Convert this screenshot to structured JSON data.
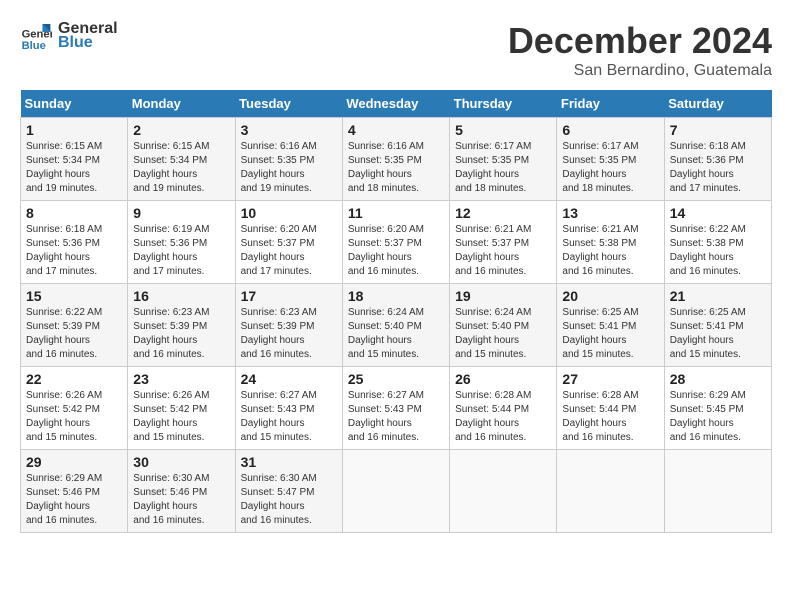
{
  "logo": {
    "line1": "General",
    "line2": "Blue"
  },
  "title": "December 2024",
  "location": "San Bernardino, Guatemala",
  "days_of_week": [
    "Sunday",
    "Monday",
    "Tuesday",
    "Wednesday",
    "Thursday",
    "Friday",
    "Saturday"
  ],
  "weeks": [
    [
      {
        "num": "1",
        "sunrise": "6:15 AM",
        "sunset": "5:34 PM",
        "daylight": "11 hours and 19 minutes."
      },
      {
        "num": "2",
        "sunrise": "6:15 AM",
        "sunset": "5:34 PM",
        "daylight": "11 hours and 19 minutes."
      },
      {
        "num": "3",
        "sunrise": "6:16 AM",
        "sunset": "5:35 PM",
        "daylight": "11 hours and 19 minutes."
      },
      {
        "num": "4",
        "sunrise": "6:16 AM",
        "sunset": "5:35 PM",
        "daylight": "11 hours and 18 minutes."
      },
      {
        "num": "5",
        "sunrise": "6:17 AM",
        "sunset": "5:35 PM",
        "daylight": "11 hours and 18 minutes."
      },
      {
        "num": "6",
        "sunrise": "6:17 AM",
        "sunset": "5:35 PM",
        "daylight": "11 hours and 18 minutes."
      },
      {
        "num": "7",
        "sunrise": "6:18 AM",
        "sunset": "5:36 PM",
        "daylight": "11 hours and 17 minutes."
      }
    ],
    [
      {
        "num": "8",
        "sunrise": "6:18 AM",
        "sunset": "5:36 PM",
        "daylight": "11 hours and 17 minutes."
      },
      {
        "num": "9",
        "sunrise": "6:19 AM",
        "sunset": "5:36 PM",
        "daylight": "11 hours and 17 minutes."
      },
      {
        "num": "10",
        "sunrise": "6:20 AM",
        "sunset": "5:37 PM",
        "daylight": "11 hours and 17 minutes."
      },
      {
        "num": "11",
        "sunrise": "6:20 AM",
        "sunset": "5:37 PM",
        "daylight": "11 hours and 16 minutes."
      },
      {
        "num": "12",
        "sunrise": "6:21 AM",
        "sunset": "5:37 PM",
        "daylight": "11 hours and 16 minutes."
      },
      {
        "num": "13",
        "sunrise": "6:21 AM",
        "sunset": "5:38 PM",
        "daylight": "11 hours and 16 minutes."
      },
      {
        "num": "14",
        "sunrise": "6:22 AM",
        "sunset": "5:38 PM",
        "daylight": "11 hours and 16 minutes."
      }
    ],
    [
      {
        "num": "15",
        "sunrise": "6:22 AM",
        "sunset": "5:39 PM",
        "daylight": "11 hours and 16 minutes."
      },
      {
        "num": "16",
        "sunrise": "6:23 AM",
        "sunset": "5:39 PM",
        "daylight": "11 hours and 16 minutes."
      },
      {
        "num": "17",
        "sunrise": "6:23 AM",
        "sunset": "5:39 PM",
        "daylight": "11 hours and 16 minutes."
      },
      {
        "num": "18",
        "sunrise": "6:24 AM",
        "sunset": "5:40 PM",
        "daylight": "11 hours and 15 minutes."
      },
      {
        "num": "19",
        "sunrise": "6:24 AM",
        "sunset": "5:40 PM",
        "daylight": "11 hours and 15 minutes."
      },
      {
        "num": "20",
        "sunrise": "6:25 AM",
        "sunset": "5:41 PM",
        "daylight": "11 hours and 15 minutes."
      },
      {
        "num": "21",
        "sunrise": "6:25 AM",
        "sunset": "5:41 PM",
        "daylight": "11 hours and 15 minutes."
      }
    ],
    [
      {
        "num": "22",
        "sunrise": "6:26 AM",
        "sunset": "5:42 PM",
        "daylight": "11 hours and 15 minutes."
      },
      {
        "num": "23",
        "sunrise": "6:26 AM",
        "sunset": "5:42 PM",
        "daylight": "11 hours and 15 minutes."
      },
      {
        "num": "24",
        "sunrise": "6:27 AM",
        "sunset": "5:43 PM",
        "daylight": "11 hours and 15 minutes."
      },
      {
        "num": "25",
        "sunrise": "6:27 AM",
        "sunset": "5:43 PM",
        "daylight": "11 hours and 16 minutes."
      },
      {
        "num": "26",
        "sunrise": "6:28 AM",
        "sunset": "5:44 PM",
        "daylight": "11 hours and 16 minutes."
      },
      {
        "num": "27",
        "sunrise": "6:28 AM",
        "sunset": "5:44 PM",
        "daylight": "11 hours and 16 minutes."
      },
      {
        "num": "28",
        "sunrise": "6:29 AM",
        "sunset": "5:45 PM",
        "daylight": "11 hours and 16 minutes."
      }
    ],
    [
      {
        "num": "29",
        "sunrise": "6:29 AM",
        "sunset": "5:46 PM",
        "daylight": "11 hours and 16 minutes."
      },
      {
        "num": "30",
        "sunrise": "6:30 AM",
        "sunset": "5:46 PM",
        "daylight": "11 hours and 16 minutes."
      },
      {
        "num": "31",
        "sunrise": "6:30 AM",
        "sunset": "5:47 PM",
        "daylight": "11 hours and 16 minutes."
      },
      null,
      null,
      null,
      null
    ]
  ]
}
